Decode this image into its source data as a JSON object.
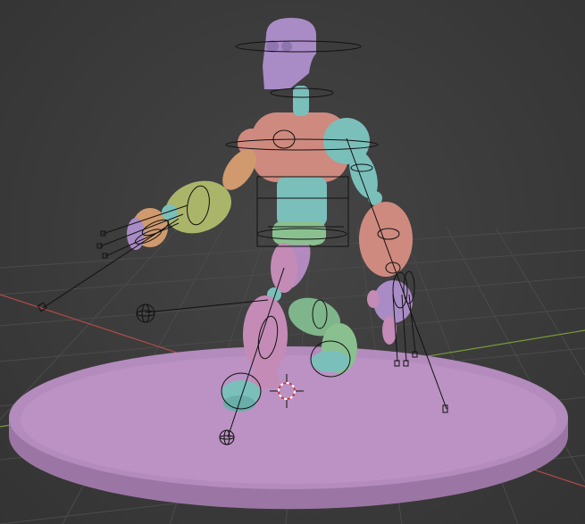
{
  "viewport": {
    "background": "#3d3d3d",
    "grid_color": "#4a4a4a",
    "x_axis_color": "#b24a4a",
    "y_axis_color": "#7a9a3a"
  },
  "scene": {
    "platform_color": "#b48bbd",
    "robot_parts": {
      "head": "#a98bc6",
      "torso": "#cf8a7f",
      "joints": "#7bbfbb",
      "left_arm": "#aab56a",
      "right_arm": "#cf8a7f",
      "legs": "#c48bb6",
      "feet": "#7bbfbb",
      "shin_left": "#7fb58a"
    },
    "icons": [
      "bone-controller-circle-icon",
      "ik-target-icon",
      "pole-target-icon",
      "3d-cursor-icon"
    ]
  }
}
